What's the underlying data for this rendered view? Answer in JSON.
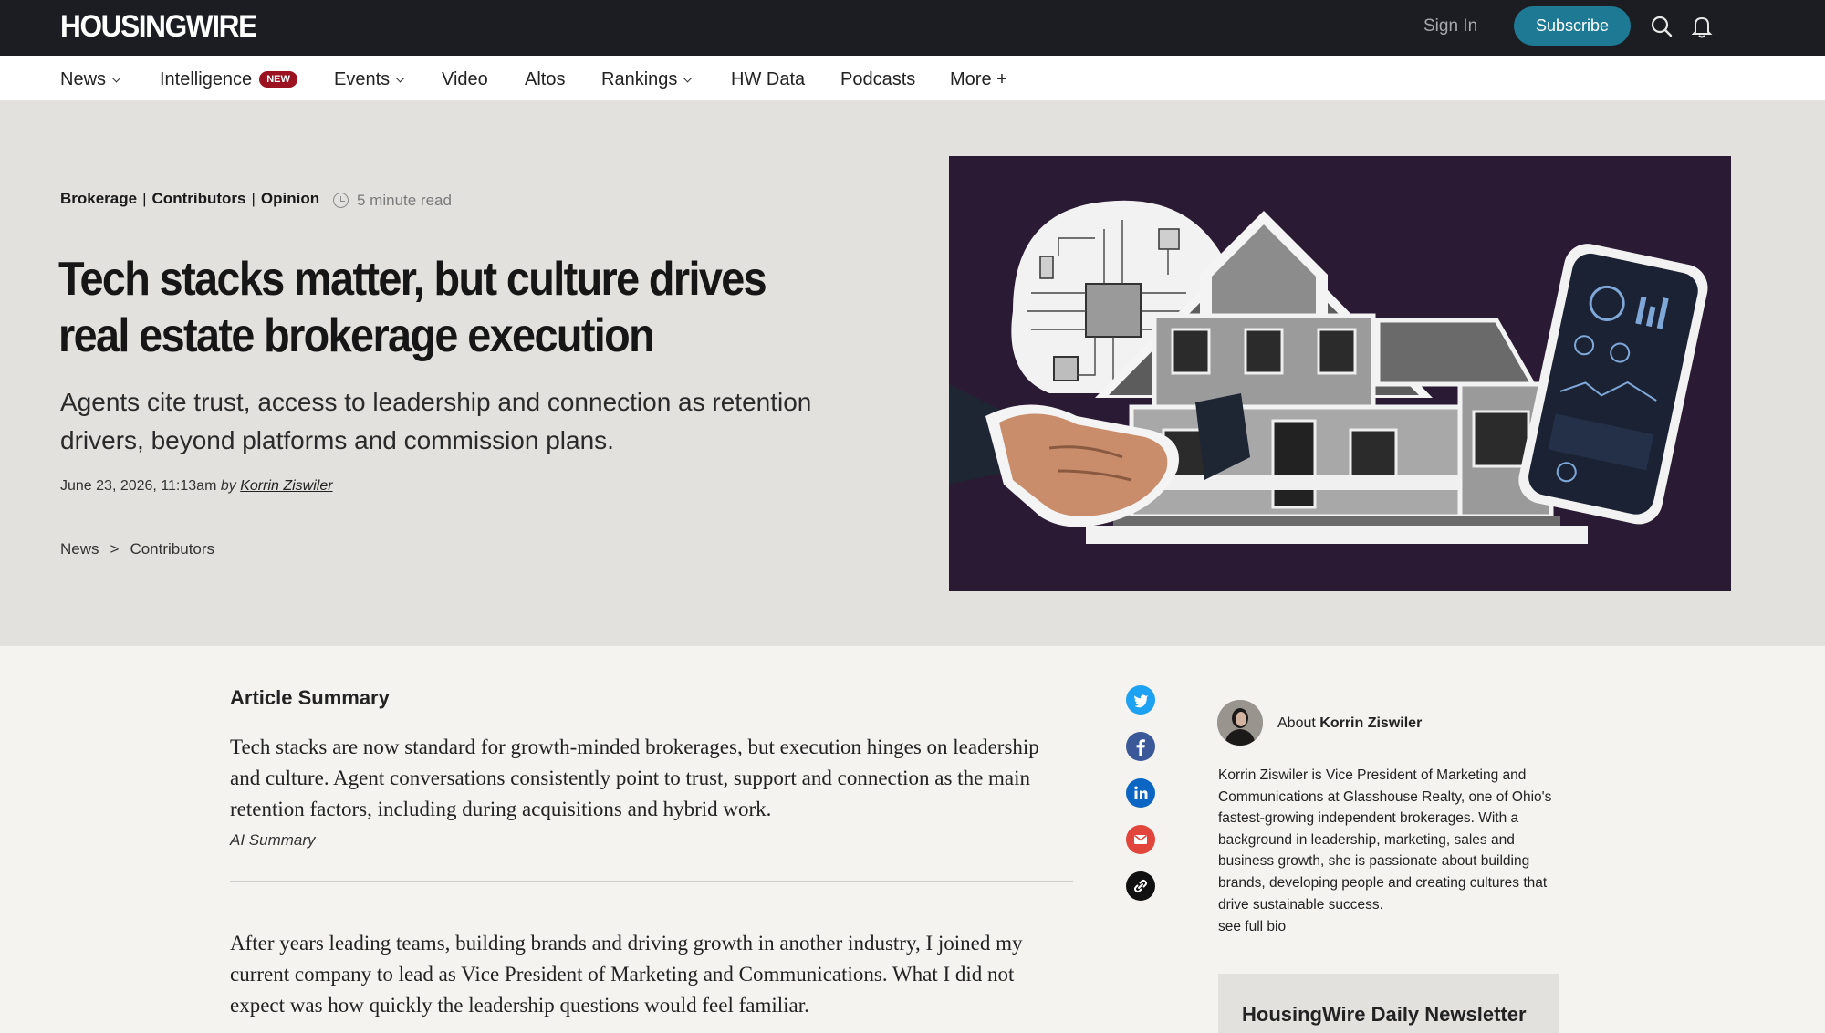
{
  "header": {
    "logo": "HOUSINGWIRE",
    "sign_in": "Sign In",
    "subscribe": "Subscribe"
  },
  "nav": {
    "news": "News",
    "intelligence": "Intelligence",
    "new_badge": "NEW",
    "events": "Events",
    "video": "Video",
    "altos": "Altos",
    "rankings": "Rankings",
    "hw_data": "HW Data",
    "podcasts": "Podcasts",
    "more": "More +"
  },
  "article": {
    "categories": [
      "Brokerage",
      "Contributors",
      "Opinion"
    ],
    "category_separator": "|",
    "read_time": "5 minute read",
    "title": "Tech stacks matter, but culture drives real estate brokerage execution",
    "dek": "Agents cite trust, access to leadership and connection as retention drivers, beyond platforms and commission plans.",
    "date": "June 23, 2026, 11:13am",
    "by": "by",
    "author": "Korrin Ziswiler",
    "breadcrumb": [
      "News",
      "Contributors"
    ],
    "breadcrumb_sep": ">",
    "summary_title": "Article Summary",
    "summary_text": "Tech stacks are now standard for growth-minded brokerages, but execution hinges on leadership and culture. Agent conversations consistently point to trust, support and connection as the main retention factors, including during acquisitions and hybrid work.",
    "ai_label": "AI Summary",
    "body_first": "After years leading teams, building brands and driving growth in another industry, I joined my current company to lead as Vice President of Marketing and Communications. What I did not expect was how quickly the leadership questions would feel familiar."
  },
  "share": {
    "icons": [
      "twitter-icon",
      "facebook-icon",
      "linkedin-icon",
      "email-icon",
      "link-icon"
    ],
    "colors": {
      "twitter": "#1da1f2",
      "facebook": "#3b5998",
      "linkedin": "#0a66c2",
      "email": "#e1453b",
      "link": "#111111"
    }
  },
  "sidebar": {
    "about_prefix": "About",
    "author_name": "Korrin Ziswiler",
    "bio": "Korrin Ziswiler is Vice President of Marketing and Communications at Glasshouse Realty, one of Ohio's fastest-growing independent brokerages. With a background in leadership, marketing, sales and business growth, she is passionate about building brands, developing people and creating cultures that drive sustainable success.",
    "see_full_bio": "see full bio",
    "newsletter_title": "HousingWire Daily Newsletter"
  },
  "colors": {
    "topbar": "#1b1d22",
    "accent": "#1e7994",
    "badge": "#9b1320",
    "hero_bg": "#e3e1dd",
    "image_bg": "#2a1a33"
  }
}
